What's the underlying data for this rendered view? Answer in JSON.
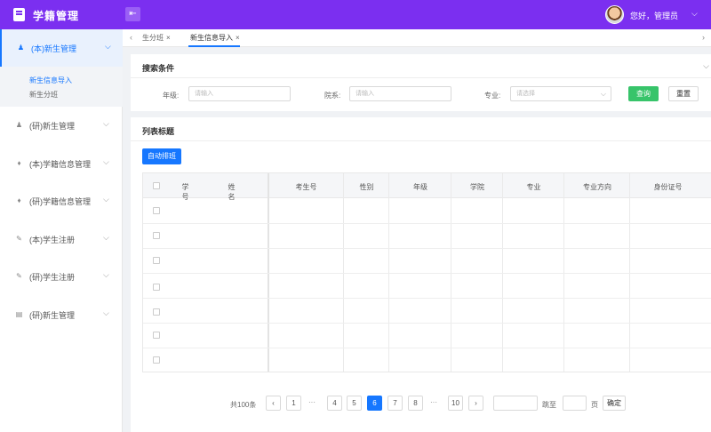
{
  "header": {
    "app_title": "学籍管理",
    "greeting": "您好，管理员",
    "collapse_icon": "menu-fold-icon",
    "brand_color": "#7b2ff0"
  },
  "sidebar": {
    "items": [
      {
        "label": "(本)新生管理",
        "icon": "user-icon",
        "expanded": true,
        "children": [
          {
            "label": "新生信息导入",
            "active": true
          },
          {
            "label": "新生分班",
            "active": false
          }
        ]
      },
      {
        "label": "(研)新生管理",
        "icon": "user-icon"
      },
      {
        "label": "(本)学籍信息管理",
        "icon": "graduation-cap-icon"
      },
      {
        "label": "(研)学籍信息管理",
        "icon": "graduation-cap-icon"
      },
      {
        "label": "(本)学生注册",
        "icon": "edit-icon"
      },
      {
        "label": "(研)学生注册",
        "icon": "edit-icon"
      },
      {
        "label": "(研)新生管理",
        "icon": "archive-icon"
      }
    ]
  },
  "tabs": [
    {
      "label": "生分班",
      "active": false
    },
    {
      "label": "新生信息导入",
      "active": true
    }
  ],
  "search": {
    "title": "搜索条件",
    "fields": [
      {
        "label": "年级:",
        "placeholder": "请输入"
      },
      {
        "label": "院系:",
        "placeholder": "请输入"
      },
      {
        "label": "专业:",
        "placeholder": "请选择"
      }
    ],
    "query_label": "查询",
    "reset_label": "重置",
    "query_color": "#37c46a"
  },
  "list": {
    "title": "列表标题",
    "auto_button": "自动排班",
    "columns": [
      "学号",
      "姓名",
      "考生号",
      "性别",
      "年级",
      "学院",
      "专业",
      "专业方向",
      "身份证号"
    ],
    "row_count": 7
  },
  "pagination": {
    "total": "共100条",
    "pages": [
      "1",
      "4",
      "5",
      "6",
      "7",
      "8",
      "10"
    ],
    "current": "6",
    "jump_label": "跳至",
    "page_unit": "页",
    "confirm_label": "确定",
    "prev": "‹",
    "next": "›",
    "ellipsis": "···"
  },
  "colors": {
    "accent": "#1677ff"
  }
}
